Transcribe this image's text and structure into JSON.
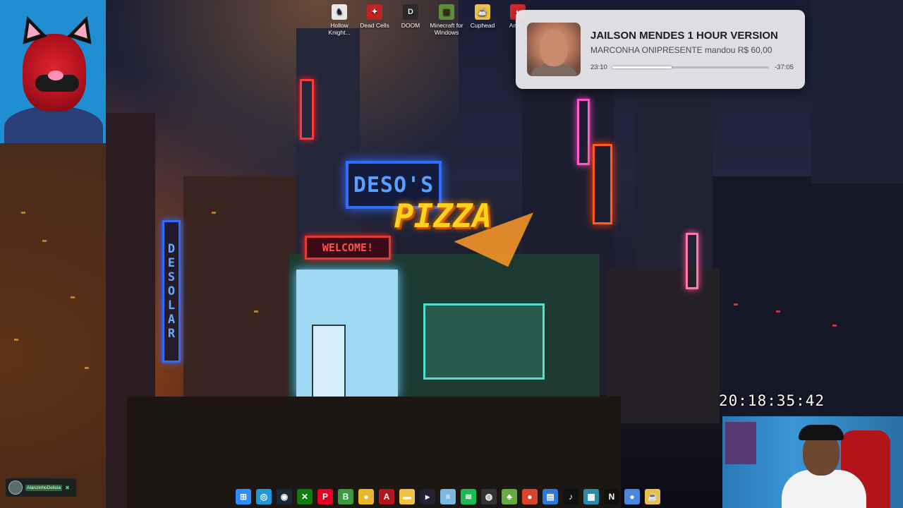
{
  "desktop_icons": [
    {
      "label": "Hollow Knight...",
      "icon": "hollow-knight-icon",
      "color": "#e8e8e8",
      "glyph": "♞"
    },
    {
      "label": "Dead Cells",
      "icon": "dead-cells-icon",
      "color": "#c02323",
      "glyph": "✦"
    },
    {
      "label": "DOOM",
      "icon": "doom-icon",
      "color": "#2a2a2a",
      "glyph": "D"
    },
    {
      "label": "Minecraft for Windows",
      "icon": "minecraft-icon",
      "color": "#5d8f3a",
      "glyph": "▣"
    },
    {
      "label": "Cuphead",
      "icon": "cuphead-icon",
      "color": "#e8c04a",
      "glyph": "☕"
    },
    {
      "label": "Amo...",
      "icon": "among-us-icon",
      "color": "#d42b2b",
      "glyph": "◐"
    }
  ],
  "notification": {
    "title": "JAILSON MENDES 1 HOUR VERSION",
    "subtitle": "MARCONHA ONIPRESENTE mandou R$ 60,00",
    "current_time": "23:10",
    "remaining_time": "-37:05",
    "progress": 0.38
  },
  "clock": "20:18:35:42",
  "chat": {
    "username": "AlanzinhoDelicia"
  },
  "signs": {
    "deso": "DESO'S",
    "pizza": "PIZZA",
    "welcome": "WELCOME!",
    "desolar": "DESOLAR"
  },
  "taskbar": [
    {
      "icon": "windows-start-icon",
      "glyph": "⊞",
      "color": "#2f8cff"
    },
    {
      "icon": "edge-icon",
      "glyph": "◎",
      "color": "#1f9ad6"
    },
    {
      "icon": "steam-icon",
      "glyph": "◉",
      "color": "#1b2838"
    },
    {
      "icon": "xbox-icon",
      "glyph": "✕",
      "color": "#107c10"
    },
    {
      "icon": "pinterest-icon",
      "glyph": "P",
      "color": "#e60023"
    },
    {
      "icon": "b-app-icon",
      "glyph": "B",
      "color": "#3c9a3c"
    },
    {
      "icon": "chrome-icon",
      "glyph": "●",
      "color": "#e8b82a"
    },
    {
      "icon": "adobe-icon",
      "glyph": "A",
      "color": "#b3151e"
    },
    {
      "icon": "file-explorer-icon",
      "glyph": "▬",
      "color": "#f0c040"
    },
    {
      "icon": "terminal-icon",
      "glyph": "▸",
      "color": "#223"
    },
    {
      "icon": "notepad-icon",
      "glyph": "≡",
      "color": "#7ab8e0"
    },
    {
      "icon": "spotify-icon",
      "glyph": "≋",
      "color": "#1db954"
    },
    {
      "icon": "obs-icon",
      "glyph": "◍",
      "color": "#333"
    },
    {
      "icon": "game-app-icon",
      "glyph": "♣",
      "color": "#6a4"
    },
    {
      "icon": "chrome-canary-icon",
      "glyph": "●",
      "color": "#d8452a"
    },
    {
      "icon": "store-icon",
      "glyph": "▤",
      "color": "#2a7ad6"
    },
    {
      "icon": "tiktok-icon",
      "glyph": "♪",
      "color": "#111"
    },
    {
      "icon": "photos-icon",
      "glyph": "▦",
      "color": "#2a8aa8"
    },
    {
      "icon": "netflix-icon",
      "glyph": "N",
      "color": "#111"
    },
    {
      "icon": "chrome-2-icon",
      "glyph": "●",
      "color": "#4a88e0"
    },
    {
      "icon": "cuphead-taskbar-icon",
      "glyph": "☕",
      "color": "#e8c04a"
    }
  ]
}
